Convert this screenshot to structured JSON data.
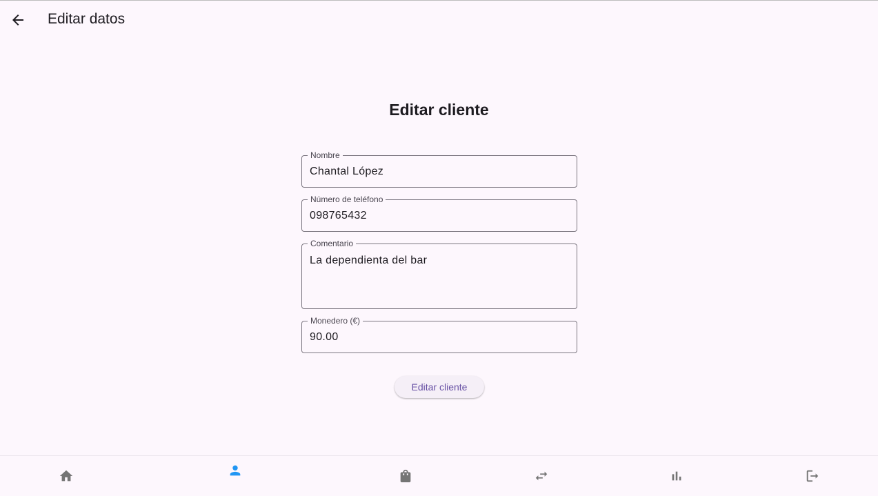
{
  "appbar": {
    "title": "Editar datos",
    "back_icon": "arrow-back-icon"
  },
  "form": {
    "title": "Editar cliente",
    "fields": {
      "name": {
        "label": "Nombre",
        "value": "Chantal López"
      },
      "phone": {
        "label": "Número de teléfono",
        "value": "098765432"
      },
      "comment": {
        "label": "Comentario",
        "value": "La dependienta del bar"
      },
      "wallet": {
        "label": "Monedero (€)",
        "value": "90.00"
      }
    },
    "submit_label": "Editar cliente"
  },
  "bottom_nav": {
    "items": [
      {
        "icon": "home-icon",
        "active": false
      },
      {
        "icon": "person-icon",
        "active": true
      },
      {
        "icon": "shopping-bag-icon",
        "active": false
      },
      {
        "icon": "swap-arrows-icon",
        "active": false
      },
      {
        "icon": "bar-chart-icon",
        "active": false
      },
      {
        "icon": "logout-icon",
        "active": false
      }
    ],
    "active_color": "#2196f3",
    "inactive_color": "#757575"
  },
  "colors": {
    "background": "#fdf7fd",
    "accent": "#6750a4",
    "outline": "#79747e"
  }
}
